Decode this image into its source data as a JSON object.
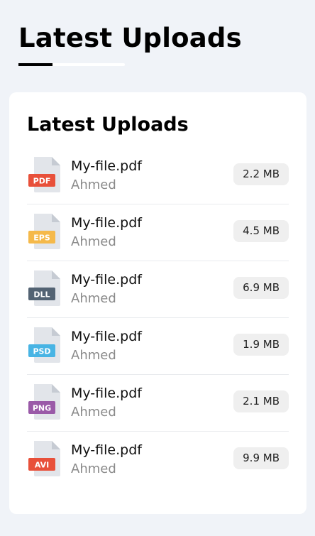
{
  "header": {
    "title": "Latest Uploads"
  },
  "card": {
    "title": "Latest Uploads",
    "files": [
      {
        "name": "My-file.pdf",
        "owner": "Ahmed",
        "type": "PDF",
        "size": "2.2 MB",
        "color": "#e8503a"
      },
      {
        "name": "My-file.pdf",
        "owner": "Ahmed",
        "type": "EPS",
        "size": "4.5 MB",
        "color": "#f5b94a"
      },
      {
        "name": "My-file.pdf",
        "owner": "Ahmed",
        "type": "DLL",
        "size": "6.9 MB",
        "color": "#536373"
      },
      {
        "name": "My-file.pdf",
        "owner": "Ahmed",
        "type": "PSD",
        "size": "1.9 MB",
        "color": "#48b4e4"
      },
      {
        "name": "My-file.pdf",
        "owner": "Ahmed",
        "type": "PNG",
        "size": "2.1 MB",
        "color": "#9a5aa8"
      },
      {
        "name": "My-file.pdf",
        "owner": "Ahmed",
        "type": "AVI",
        "size": "9.9 MB",
        "color": "#e8503a"
      }
    ]
  },
  "icons": {
    "file": "document-icon"
  }
}
